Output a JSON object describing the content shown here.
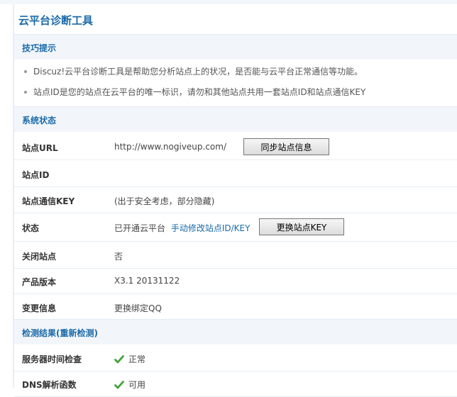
{
  "page_title": "云平台诊断工具",
  "tips": {
    "header": "技巧提示",
    "items": [
      "Discuz!云平台诊断工具是帮助您分析站点上的状况，是否能与云平台正常通信等功能。",
      "站点ID是您的站点在云平台的唯一标识，请勿和其他站点共用一套站点ID和站点通信KEY"
    ]
  },
  "system_status": {
    "header": "系统状态",
    "site_url_label": "站点URL",
    "site_url_value": "http://www.nogiveup.com/",
    "sync_button": "同步站点信息",
    "site_id_label": "站点ID",
    "site_id_value": "",
    "site_key_label": "站点通信KEY",
    "site_key_value": "(出于安全考虑，部分隐藏)",
    "status_label": "状态",
    "status_value": "已开通云平台",
    "manual_edit_link": "手动修改站点ID/KEY",
    "change_key_button": "更换站点KEY",
    "close_site_label": "关闭站点",
    "close_site_value": "否",
    "version_label": "产品版本",
    "version_value": "X3.1 20131122",
    "change_info_label": "变更信息",
    "change_info_link": "更换绑定QQ"
  },
  "detection": {
    "header": "检测结果(重新检测)",
    "items": [
      {
        "label": "服务器时间检查",
        "status": "正常"
      },
      {
        "label": "DNS解析函数",
        "status": "可用"
      }
    ]
  },
  "colors": {
    "accent": "#1b6aa8",
    "check": "#3fa33a"
  }
}
